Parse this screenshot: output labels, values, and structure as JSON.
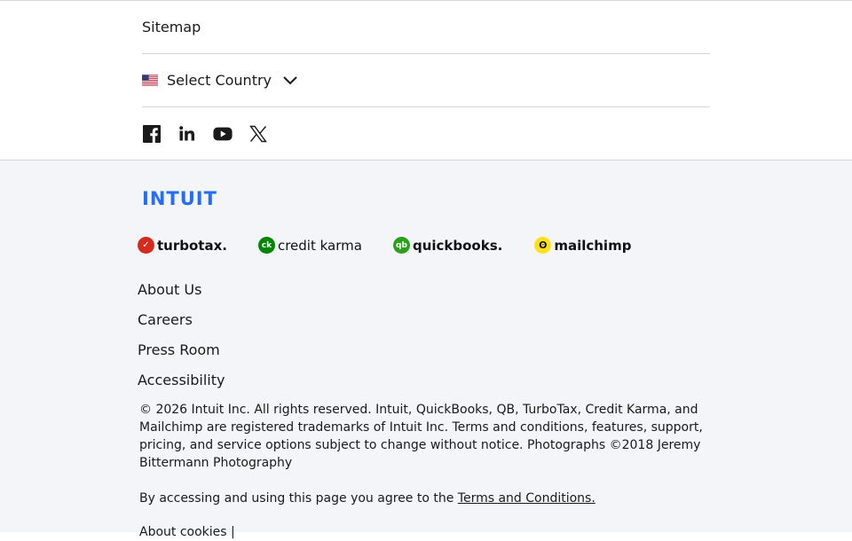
{
  "top": {
    "sitemap_label": "Sitemap",
    "country_label": "Select Country",
    "country_flag": "us-flag",
    "social": [
      {
        "name": "facebook-icon"
      },
      {
        "name": "linkedin-icon"
      },
      {
        "name": "youtube-icon"
      },
      {
        "name": "x-twitter-icon"
      }
    ]
  },
  "footer": {
    "logo_text": "INTUIT",
    "logo_color": "#236cff",
    "brands": [
      {
        "label": "turbotax.",
        "color": "#d52b1e"
      },
      {
        "label": "credit karma",
        "color": "#008600"
      },
      {
        "label": "quickbooks.",
        "color": "#2ca01c"
      },
      {
        "label": "mailchimp",
        "color": "#ffe01b"
      }
    ],
    "links": [
      "About Us",
      "Careers",
      "Press Room",
      "Accessibility"
    ],
    "legal": "© 2026 Intuit Inc. All rights reserved. Intuit, QuickBooks, QB, TurboTax, Credit Karma, and Mailchimp are registered trademarks of Intuit Inc. Terms and conditions, features, support, pricing, and service options subject to change without notice. Photographs ©2018 Jeremy Bittermann Photography",
    "agree_prefix": "By accessing and using this page you agree to the ",
    "agree_link": "Terms and Conditions.",
    "cookies_label": "About cookies |"
  }
}
